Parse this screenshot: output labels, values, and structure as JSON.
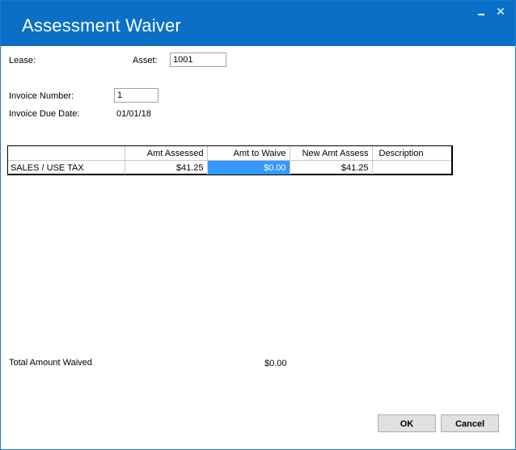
{
  "window": {
    "title": "Assessment Waiver",
    "minimize_glyph": "_",
    "close_glyph": "✕"
  },
  "form": {
    "lease_label": "Lease:",
    "asset_label": "Asset:",
    "asset_value": "1001",
    "invoice_number_label": "Invoice Number:",
    "invoice_number_value": "1",
    "invoice_due_date_label": "Invoice Due Date:",
    "invoice_due_date_value": "01/01/18"
  },
  "grid": {
    "columns": [
      "",
      "Amt Assessed",
      "Amt to Waive",
      "New Amt Assess",
      "Description"
    ],
    "rows": [
      {
        "item": "SALES / USE TAX",
        "amt_assessed": "$41.25",
        "amt_to_waive": "$0.00",
        "new_amt_assess": "$41.25",
        "description": ""
      }
    ],
    "selected_color": "#3399ff"
  },
  "totals": {
    "total_waived_label": "Total Amount Waived",
    "total_waived_value": "$0.00"
  },
  "buttons": {
    "ok_label": "OK",
    "cancel_label": "Cancel"
  },
  "colors": {
    "titlebar": "#0a70c7",
    "accent": "#3399ff"
  }
}
